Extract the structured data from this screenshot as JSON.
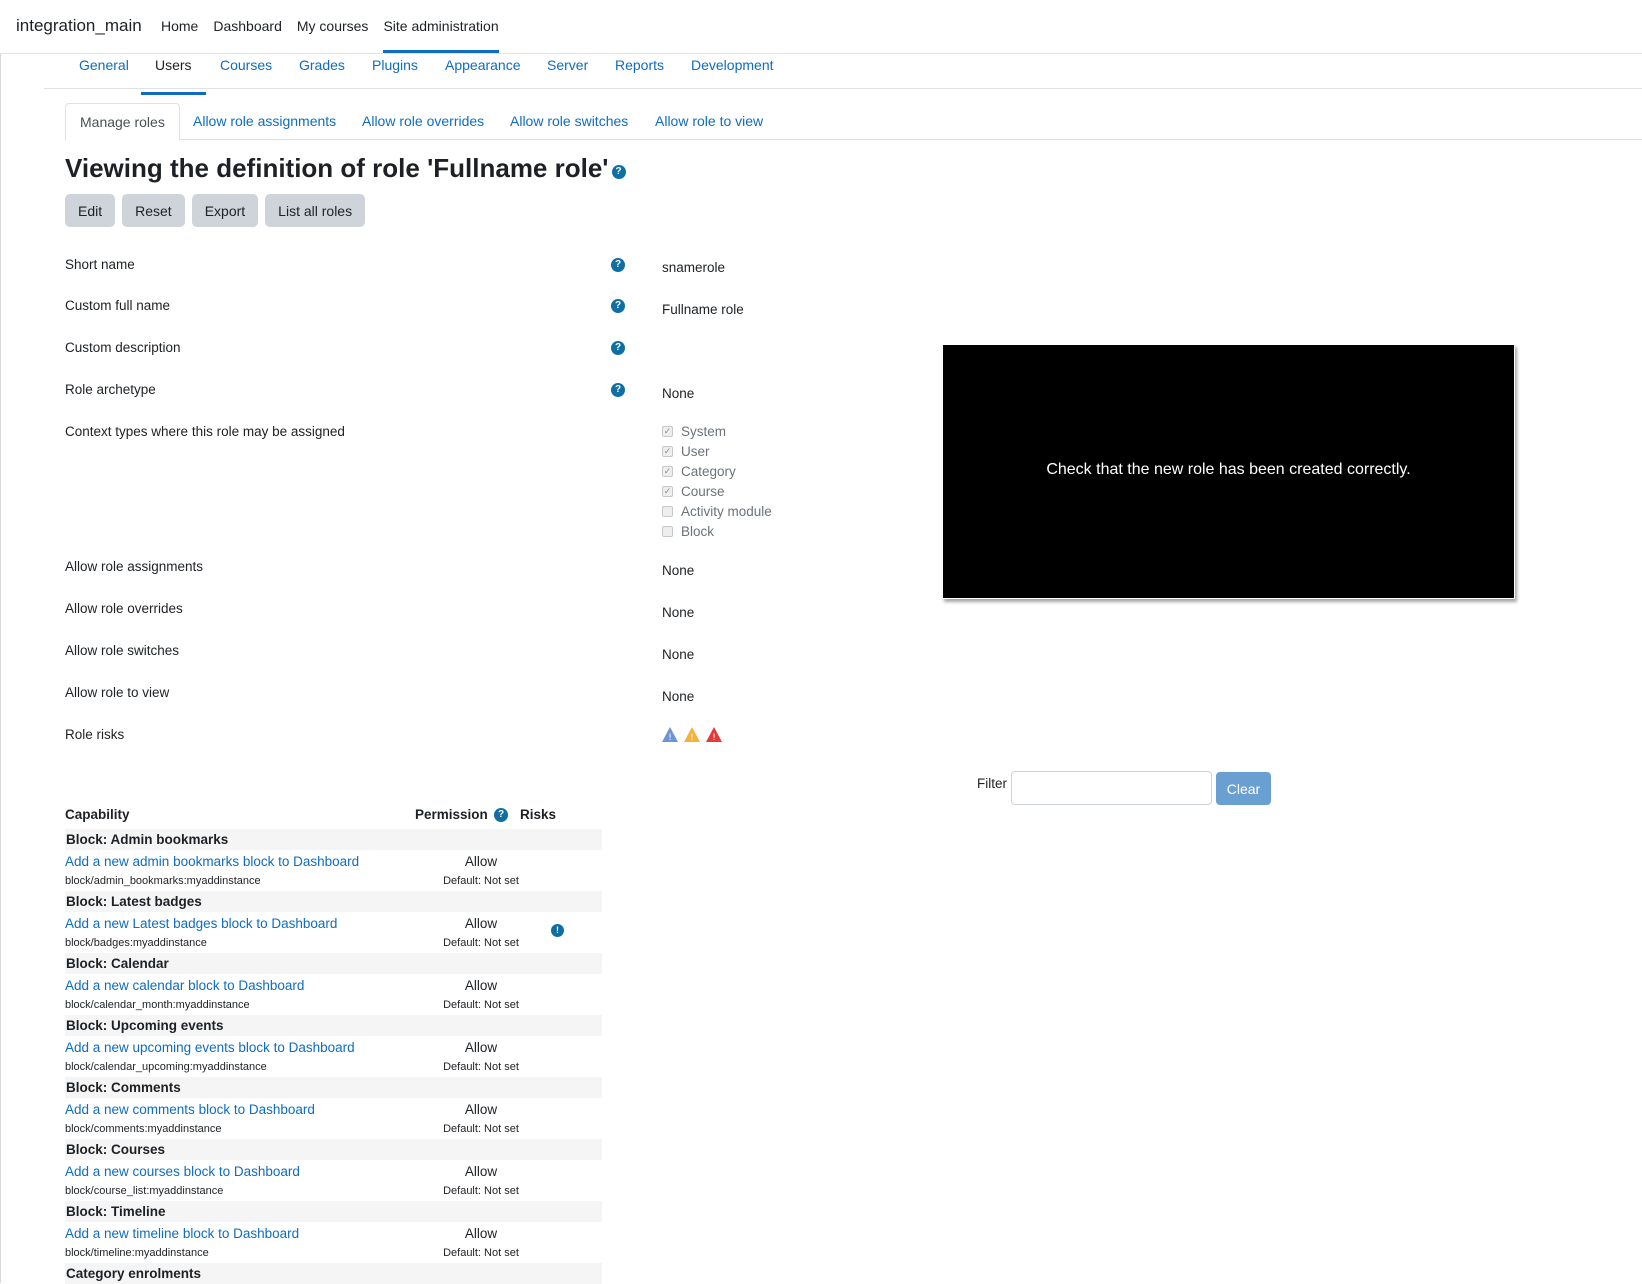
{
  "navbar": {
    "brand": "integration_main",
    "items": [
      "Home",
      "Dashboard",
      "My courses",
      "Site administration"
    ],
    "active_index": 3
  },
  "secondary_nav": {
    "items": [
      "General",
      "Users",
      "Courses",
      "Grades",
      "Plugins",
      "Appearance",
      "Server",
      "Reports",
      "Development"
    ],
    "active_index": 1
  },
  "tabs": {
    "items": [
      "Manage roles",
      "Allow role assignments",
      "Allow role overrides",
      "Allow role switches",
      "Allow role to view"
    ],
    "active_index": 0
  },
  "page": {
    "title": "Viewing the definition of role 'Fullname role'",
    "help_glyph": "?"
  },
  "buttons": {
    "edit": "Edit",
    "reset": "Reset",
    "export": "Export",
    "list_all": "List all roles"
  },
  "definition": {
    "short_name": {
      "label": "Short name",
      "value": "snamerole"
    },
    "full_name": {
      "label": "Custom full name",
      "value": "Fullname role"
    },
    "description": {
      "label": "Custom description",
      "value": ""
    },
    "archetype": {
      "label": "Role archetype",
      "value": "None"
    },
    "context_types": {
      "label": "Context types where this role may be assigned",
      "options": [
        {
          "label": "System",
          "checked": true
        },
        {
          "label": "User",
          "checked": true
        },
        {
          "label": "Category",
          "checked": true
        },
        {
          "label": "Course",
          "checked": true
        },
        {
          "label": "Activity module",
          "checked": false
        },
        {
          "label": "Block",
          "checked": false
        }
      ]
    },
    "allow_assign": {
      "label": "Allow role assignments",
      "value": "None"
    },
    "allow_override": {
      "label": "Allow role overrides",
      "value": "None"
    },
    "allow_switch": {
      "label": "Allow role switches",
      "value": "None"
    },
    "allow_view": {
      "label": "Allow role to view",
      "value": "None"
    },
    "risks": {
      "label": "Role risks",
      "icons": [
        "risk-xss-icon",
        "risk-config-icon",
        "risk-data-loss-icon"
      ]
    }
  },
  "overlay": {
    "message": "Check that the new role has been created correctly."
  },
  "filter": {
    "label": "Filter",
    "value": "",
    "clear_label": "Clear"
  },
  "capabilities": {
    "headers": {
      "capability": "Capability",
      "permission": "Permission",
      "risks": "Risks"
    },
    "groups": [
      {
        "name": "Block: Admin bookmarks",
        "items": [
          {
            "label": "Add a new admin bookmarks block to Dashboard",
            "id": "block/admin_bookmarks:myaddinstance",
            "permission": "Allow",
            "default": "Default: Not set",
            "risk": false
          }
        ]
      },
      {
        "name": "Block: Latest badges",
        "items": [
          {
            "label": "Add a new Latest badges block to Dashboard",
            "id": "block/badges:myaddinstance",
            "permission": "Allow",
            "default": "Default: Not set",
            "risk": true
          }
        ]
      },
      {
        "name": "Block: Calendar",
        "items": [
          {
            "label": "Add a new calendar block to Dashboard",
            "id": "block/calendar_month:myaddinstance",
            "permission": "Allow",
            "default": "Default: Not set",
            "risk": false
          }
        ]
      },
      {
        "name": "Block: Upcoming events",
        "items": [
          {
            "label": "Add a new upcoming events block to Dashboard",
            "id": "block/calendar_upcoming:myaddinstance",
            "permission": "Allow",
            "default": "Default: Not set",
            "risk": false
          }
        ]
      },
      {
        "name": "Block: Comments",
        "items": [
          {
            "label": "Add a new comments block to Dashboard",
            "id": "block/comments:myaddinstance",
            "permission": "Allow",
            "default": "Default: Not set",
            "risk": false
          }
        ]
      },
      {
        "name": "Block: Courses",
        "items": [
          {
            "label": "Add a new courses block to Dashboard",
            "id": "block/course_list:myaddinstance",
            "permission": "Allow",
            "default": "Default: Not set",
            "risk": false
          }
        ]
      },
      {
        "name": "Block: Timeline",
        "items": [
          {
            "label": "Add a new timeline block to Dashboard",
            "id": "block/timeline:myaddinstance",
            "permission": "Allow",
            "default": "Default: Not set",
            "risk": false
          }
        ]
      },
      {
        "name": "Category enrolments",
        "items": []
      }
    ]
  },
  "colors": {
    "link": "#0f6cbf",
    "help": "#0f6fa3",
    "button": "#ced4da",
    "clear_button": "#6a9fd1"
  }
}
